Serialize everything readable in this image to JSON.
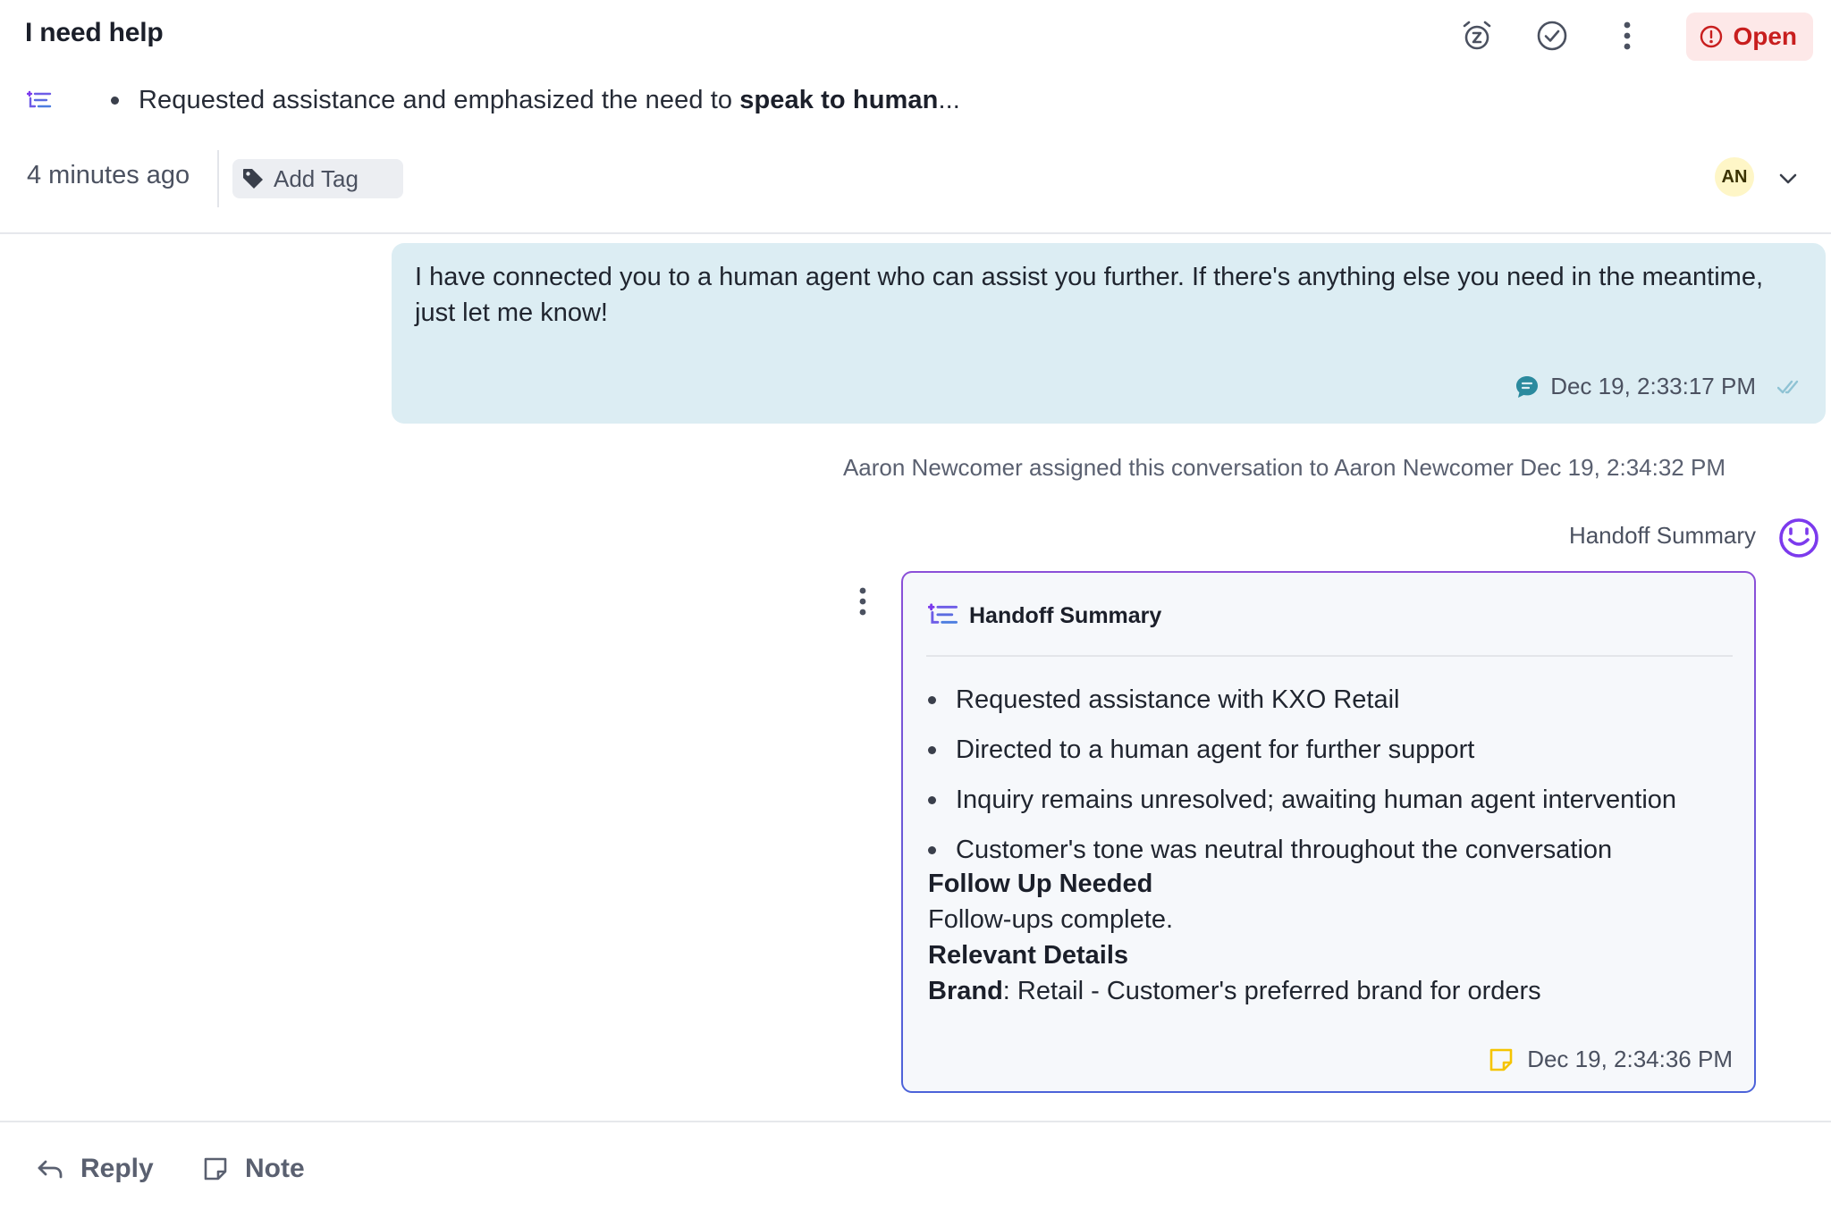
{
  "header": {
    "title": "I need help",
    "summary_prefix": "Requested assistance and emphasized the need to ",
    "summary_bold": "speak to human",
    "summary_suffix": "...",
    "time_ago": "4 minutes ago",
    "add_tag_label": "Add Tag",
    "status_label": "Open",
    "assignee_initials": "AN"
  },
  "messages": {
    "bot_text": "I have connected you to a human agent who can assist you further. If there's anything else you need in the meantime, just let me know!",
    "bot_time": "Dec 19, 2:33:17 PM",
    "activity": "Aaron Newcomer assigned this conversation to Aaron Newcomer Dec 19, 2:34:32 PM",
    "handoff_label": "Handoff Summary"
  },
  "handoff": {
    "title": "Handoff Summary",
    "items": [
      "Requested assistance with KXO Retail",
      "Directed to a human agent for further support",
      "Inquiry remains unresolved; awaiting human agent intervention",
      "Customer's tone was neutral throughout the conversation"
    ],
    "follow_up_heading": "Follow Up Needed",
    "follow_up_text": "Follow-ups complete.",
    "details_heading": "Relevant Details",
    "brand_key": "Brand",
    "brand_value": ": Retail - Customer's preferred brand for orders",
    "time": "Dec 19, 2:34:36 PM"
  },
  "footer": {
    "reply_label": "Reply",
    "note_label": "Note"
  },
  "colors": {
    "status_bg": "#fde8e8",
    "status_text": "#c81e1e",
    "bot_bubble": "#dcedf3",
    "ai_purple": "#8b4fd8",
    "note_yellow": "#f5c400"
  },
  "icons": {
    "summary": "ai-summary-icon",
    "snooze": "snooze-alarm-icon",
    "resolve": "check-circle-icon",
    "more": "more-vertical-icon",
    "alert": "alert-circle-icon",
    "tag": "tag-icon",
    "chevron": "chevron-down-icon",
    "chat": "chat-bubble-icon",
    "delivered": "double-check-icon",
    "bot": "bot-face-icon",
    "note": "sticky-note-icon",
    "reply": "reply-arrow-icon"
  }
}
